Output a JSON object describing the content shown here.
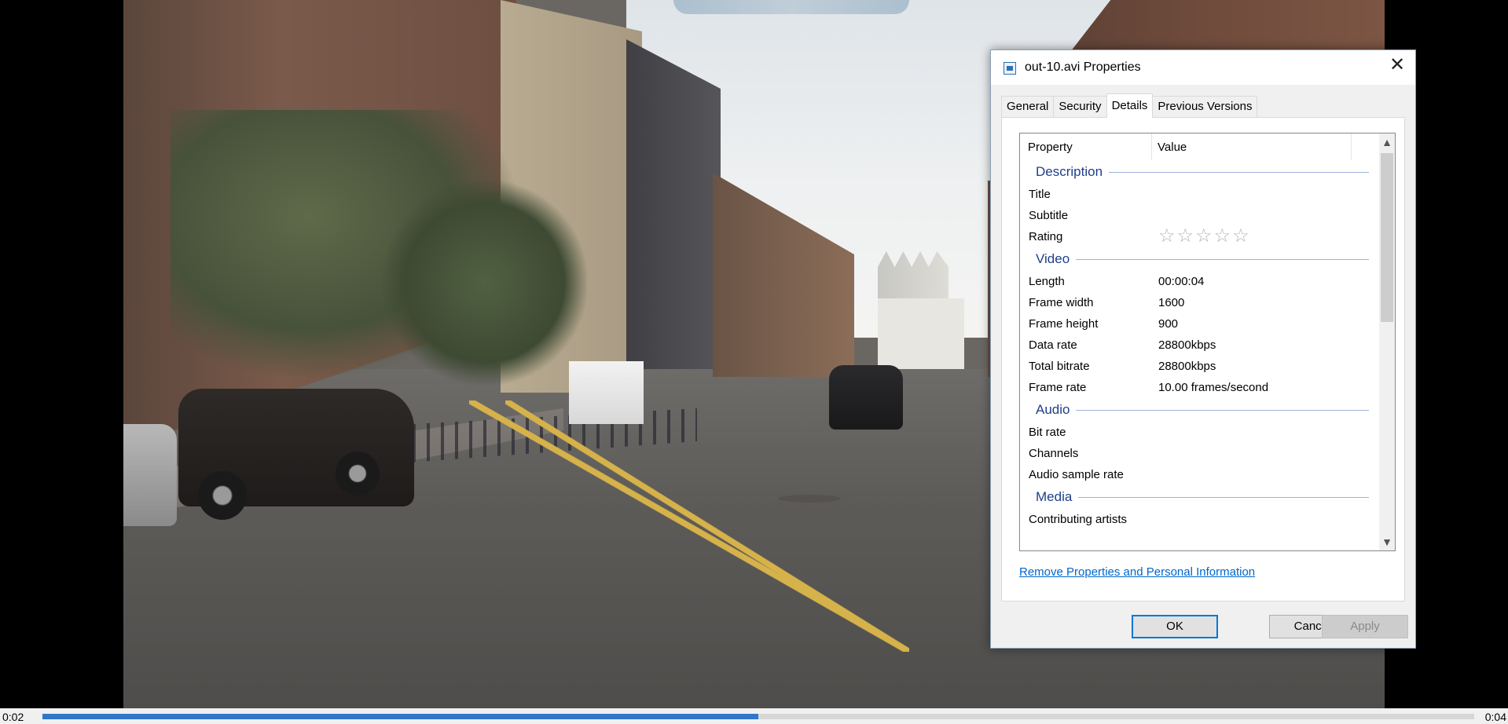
{
  "player": {
    "current_time": "0:02",
    "total_time": "0:04",
    "progress_fraction": 0.5,
    "accent_color": "#3177c8"
  },
  "dialog": {
    "title": "out-10.avi Properties",
    "close_label": "✕",
    "tabs": [
      {
        "label": "General",
        "active": false
      },
      {
        "label": "Security",
        "active": false
      },
      {
        "label": "Details",
        "active": true
      },
      {
        "label": "Previous Versions",
        "active": false
      }
    ],
    "list_header": {
      "property": "Property",
      "value": "Value"
    },
    "groups": {
      "description": "Description",
      "video": "Video",
      "audio": "Audio",
      "media": "Media"
    },
    "rows": {
      "title": {
        "label": "Title",
        "value": ""
      },
      "subtitle": {
        "label": "Subtitle",
        "value": ""
      },
      "rating": {
        "label": "Rating",
        "stars": "☆☆☆☆☆",
        "rating_value": 0
      },
      "length": {
        "label": "Length",
        "value": "00:00:04"
      },
      "frame_width": {
        "label": "Frame width",
        "value": "1600"
      },
      "frame_height": {
        "label": "Frame height",
        "value": "900"
      },
      "data_rate": {
        "label": "Data rate",
        "value": "28800kbps"
      },
      "total_bitrate": {
        "label": "Total bitrate",
        "value": "28800kbps"
      },
      "frame_rate": {
        "label": "Frame rate",
        "value": "10.00 frames/second"
      },
      "bit_rate": {
        "label": "Bit rate",
        "value": ""
      },
      "channels": {
        "label": "Channels",
        "value": ""
      },
      "audio_sample_rate": {
        "label": "Audio sample rate",
        "value": ""
      },
      "contributing_artists": {
        "label": "Contributing artists",
        "value": ""
      }
    },
    "scroll_up_icon": "▲",
    "scroll_down_icon": "▼",
    "remove_link": "Remove Properties and Personal Information",
    "buttons": {
      "ok": "OK",
      "cancel": "Cancel",
      "apply": "Apply"
    }
  }
}
